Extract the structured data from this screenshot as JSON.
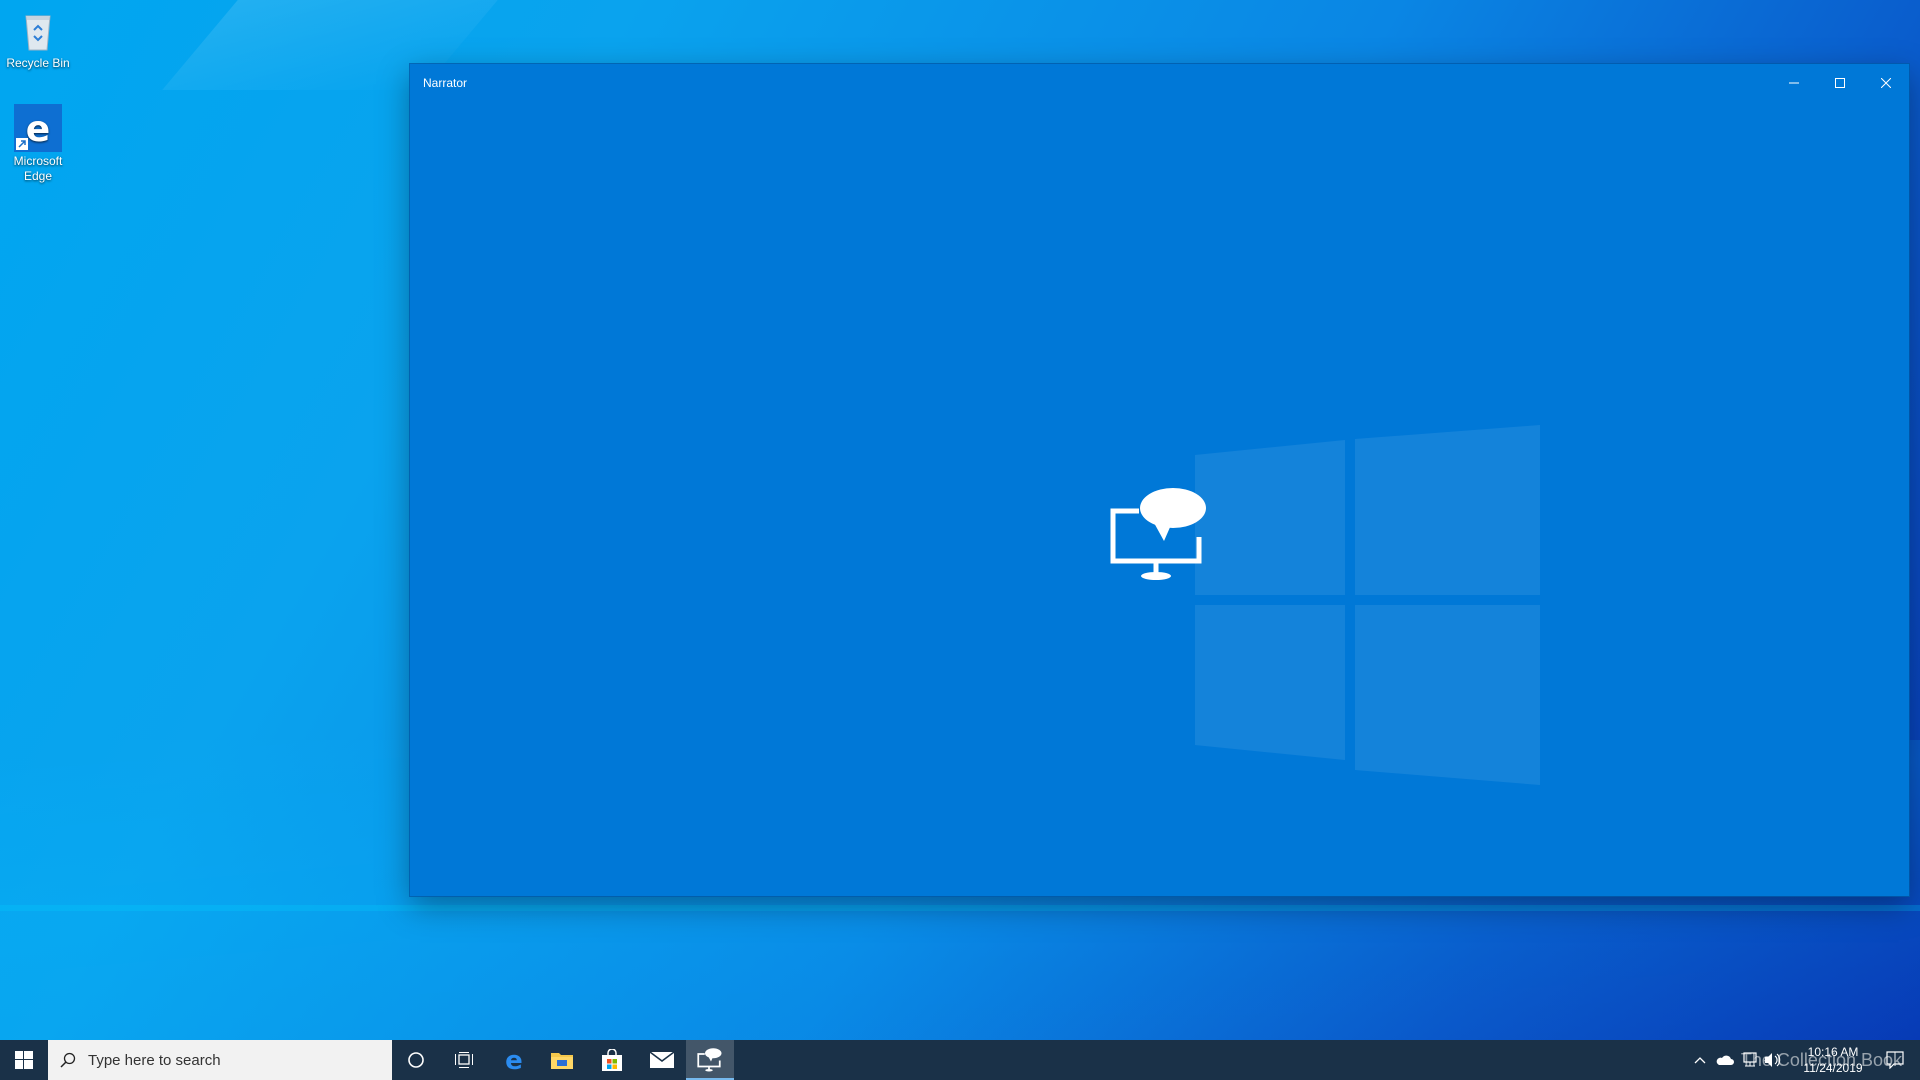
{
  "desktop": {
    "icons": [
      {
        "label": "Recycle Bin"
      },
      {
        "label": "Microsoft Edge"
      }
    ]
  },
  "window": {
    "title": "Narrator",
    "controls": {
      "minimize": "minimize-icon",
      "maximize": "maximize-icon",
      "close": "close-icon"
    },
    "background_color": "#0078d7"
  },
  "taskbar": {
    "search_placeholder": "Type here to search",
    "pinned": [
      "start",
      "cortana",
      "task-view",
      "microsoft-edge",
      "file-explorer",
      "microsoft-store",
      "mail",
      "narrator"
    ],
    "clock": {
      "time": "10:16 AM",
      "date": "11/24/2019"
    }
  },
  "watermark": "The Collection Book"
}
